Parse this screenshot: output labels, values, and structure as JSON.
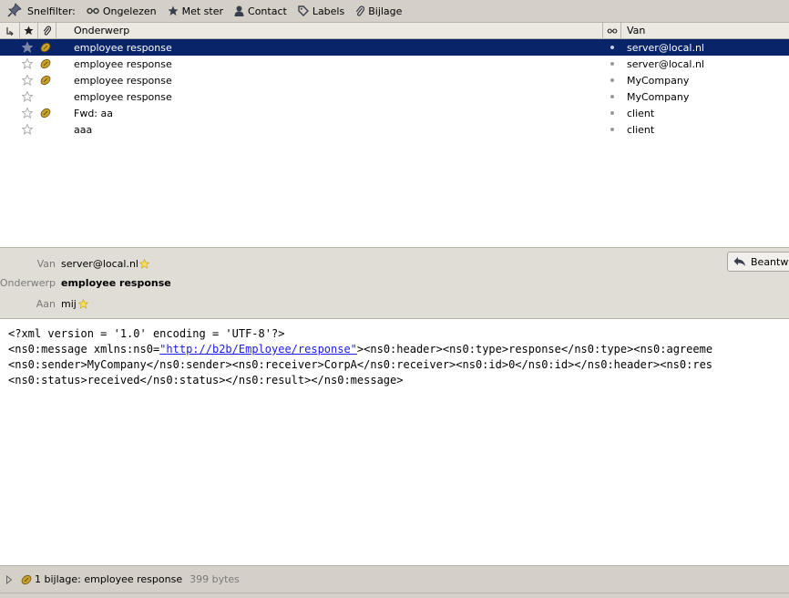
{
  "filter_bar": {
    "label": "Snelfilter:",
    "items": [
      {
        "icon": "glasses-icon",
        "label": "Ongelezen"
      },
      {
        "icon": "star-icon",
        "label": "Met ster"
      },
      {
        "icon": "person-icon",
        "label": "Contact"
      },
      {
        "icon": "tag-icon",
        "label": "Labels"
      },
      {
        "icon": "paperclip-icon",
        "label": "Bijlage"
      }
    ]
  },
  "thread_list": {
    "columns": {
      "subject": "Onderwerp",
      "from": "Van"
    },
    "rows": [
      {
        "subject": "employee response",
        "from": "server@local.nl",
        "starred": false,
        "attachment": true,
        "selected": true
      },
      {
        "subject": "employee response",
        "from": "server@local.nl",
        "starred": false,
        "attachment": true,
        "selected": false
      },
      {
        "subject": "employee response",
        "from": "MyCompany",
        "starred": false,
        "attachment": true,
        "selected": false
      },
      {
        "subject": "employee response",
        "from": "MyCompany",
        "starred": false,
        "attachment": false,
        "selected": false
      },
      {
        "subject": "Fwd: aa",
        "from": "client",
        "starred": false,
        "attachment": true,
        "selected": false
      },
      {
        "subject": "aaa",
        "from": "client",
        "starred": false,
        "attachment": false,
        "selected": false
      }
    ]
  },
  "message_header": {
    "from_label": "Van",
    "from_value": "server@local.nl",
    "subject_label": "Onderwerp",
    "subject_value": "employee response",
    "to_label": "Aan",
    "to_value": "mij",
    "reply_button": "Beantwo"
  },
  "message_body": {
    "line1": "<?xml version = '1.0' encoding = 'UTF-8'?>",
    "line2_prefix": "<ns0:message xmlns:ns0=",
    "line2_link": "\"http://b2b/Employee/response\"",
    "line2_suffix": "><ns0:header><ns0:type>response</ns0:type><ns0:agreeme",
    "line3": "<ns0:sender>MyCompany</ns0:sender><ns0:receiver>CorpA</ns0:receiver><ns0:id>0</ns0:id></ns0:header><ns0:res",
    "line4": "<ns0:status>received</ns0:status></ns0:result></ns0:message>"
  },
  "attachment_bar": {
    "label": "1 bijlage: employee response",
    "size": "399 bytes"
  },
  "colors": {
    "selection": "#0a246a",
    "chrome": "#d4d0c8",
    "link": "#1a1aee"
  }
}
